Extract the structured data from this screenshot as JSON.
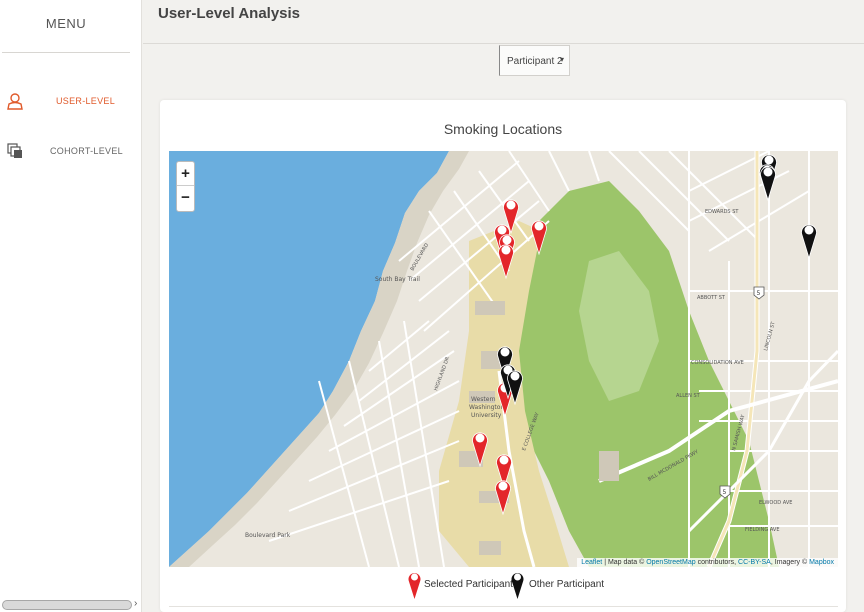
{
  "sidebar": {
    "menu_title": "MENU",
    "items": [
      {
        "label": "USER-LEVEL",
        "icon": "user-icon",
        "active": true,
        "color": "#e05a2b"
      },
      {
        "label": "COHORT-LEVEL",
        "icon": "layers-icon",
        "active": false
      }
    ],
    "scroll_arrow": "›"
  },
  "header": {
    "title": "User-Level Analysis"
  },
  "participant_select": {
    "value": "Participant 2",
    "caret": "▾"
  },
  "card": {
    "title": "Smoking Locations"
  },
  "map": {
    "zoom_in": "+",
    "zoom_out": "−",
    "attribution": {
      "leaflet": "Leaflet",
      "text1": " | Map data © ",
      "osm": "OpenStreetMap",
      "text2": " contributors, ",
      "license": "CC-BY-SA",
      "text3": ", Imagery © ",
      "mapbox": "Mapbox"
    },
    "place_labels": {
      "campus_1": "Western",
      "campus_2": "Washington",
      "campus_3": "University",
      "south_bay_trail": "South Bay Trail",
      "boulevard_park": "Boulevard Park",
      "consolidation_ave": "CONSOLIDATION AVE",
      "abbott_st": "ABBOTT ST",
      "allen_st": "ALLEN ST",
      "edwards_st": "EDWARDS ST",
      "elwood_ave": "ELWOOD AVE",
      "fielding_ave": "FIELDING AVE",
      "bill_mcdonald_pkwy": "BILL MCDONALD PKWY",
      "e_college_way": "E COLLEGE WAY",
      "highland_dr": "HIGHLAND DR",
      "boulevard": "BOULEVARD",
      "lincoln_st": "LINCOLN ST",
      "samish_way": "N SAMISH WAY",
      "i5": "5"
    },
    "colors": {
      "water": "#6aaede",
      "park": "#9cc56a",
      "campus": "#e8dca8",
      "selected": "#e3262a",
      "other": "#111111"
    }
  },
  "legend": {
    "selected_label": "Selected Participant",
    "other_label": "Other Participant"
  }
}
